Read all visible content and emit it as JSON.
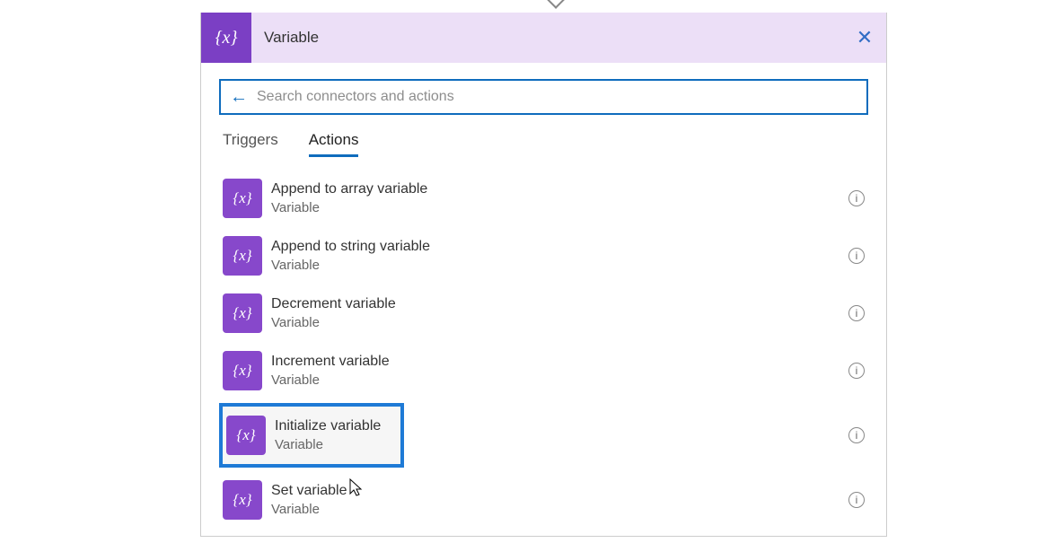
{
  "header": {
    "icon_text": "{x}",
    "title": "Variable",
    "close_label": "✕"
  },
  "search": {
    "placeholder": "Search connectors and actions",
    "value": ""
  },
  "tabs": {
    "triggers": "Triggers",
    "actions": "Actions"
  },
  "actions": [
    {
      "title": "Append to array variable",
      "sub": "Variable",
      "icon": "{x}"
    },
    {
      "title": "Append to string variable",
      "sub": "Variable",
      "icon": "{x}"
    },
    {
      "title": "Decrement variable",
      "sub": "Variable",
      "icon": "{x}"
    },
    {
      "title": "Increment variable",
      "sub": "Variable",
      "icon": "{x}"
    },
    {
      "title": "Initialize variable",
      "sub": "Variable",
      "icon": "{x}",
      "highlighted": true
    },
    {
      "title": "Set variable",
      "sub": "Variable",
      "icon": "{x}"
    }
  ]
}
